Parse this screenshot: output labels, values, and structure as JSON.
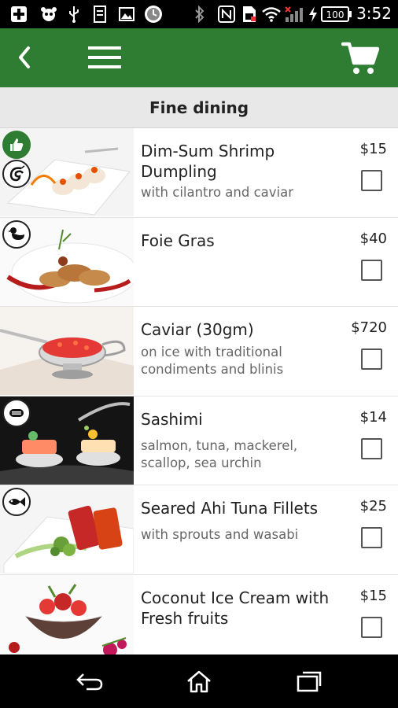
{
  "status_bar": {
    "time": "3:52",
    "battery": "100",
    "icons": [
      "plus-icon",
      "panda-icon",
      "usb-icon",
      "sd-card-icon",
      "image-icon",
      "clock-app-icon",
      "bluetooth-icon",
      "nfc-icon",
      "sim-icon",
      "wifi-icon",
      "signal-icon",
      "charging-icon",
      "battery-icon"
    ]
  },
  "app_bar": {
    "back_icon": "chevron-left-icon",
    "menu_icon": "hamburger-menu-icon",
    "cart_icon": "shopping-cart-icon",
    "color": "#2e7d32"
  },
  "section": {
    "title": "Fine dining"
  },
  "items": [
    {
      "title": "Dim-Sum Shrimp Dumpling",
      "description": "with cilantro and caviar",
      "price": "$15",
      "checked": false,
      "badges": [
        "thumbs-up-icon",
        "shrimp-icon"
      ]
    },
    {
      "title": "Foie Gras",
      "description": "",
      "price": "$40",
      "checked": false,
      "badges": [
        "duck-icon"
      ]
    },
    {
      "title": "Caviar (30gm)",
      "description": "on ice with traditional condiments and blinis",
      "price": "$720",
      "checked": false,
      "badges": []
    },
    {
      "title": "Sashimi",
      "description": "salmon, tuna, mackerel, scallop, sea urchin",
      "price": "$14",
      "checked": false,
      "badges": [
        "fish-icon"
      ]
    },
    {
      "title": "Seared Ahi Tuna Fillets",
      "description": "with sprouts and wasabi",
      "price": "$25",
      "checked": false,
      "badges": [
        "fish-icon"
      ]
    },
    {
      "title": "Coconut Ice Cream with Fresh fruits",
      "description": "",
      "price": "$15",
      "checked": false,
      "badges": []
    }
  ],
  "nav_bar": {
    "back_icon": "nav-back-icon",
    "home_icon": "nav-home-icon",
    "recents_icon": "nav-recents-icon"
  }
}
